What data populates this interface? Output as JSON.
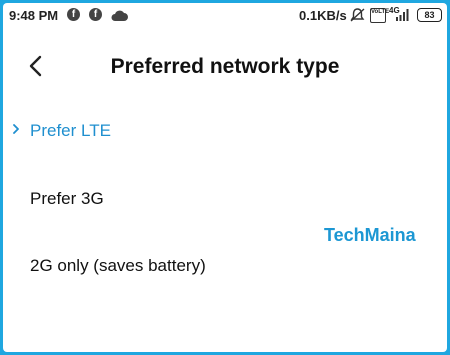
{
  "status_bar": {
    "time": "9:48 PM",
    "app_icons": [
      "facebook-icon",
      "facebook-icon",
      "cloud-icon"
    ],
    "net_speed": "0.1KB/s",
    "volte": "VoLTE",
    "network": "4G",
    "battery": "83"
  },
  "header": {
    "title": "Preferred network type",
    "back_icon": "back-arrow-icon"
  },
  "options": [
    {
      "label": "Prefer LTE",
      "selected": true
    },
    {
      "label": "Prefer 3G",
      "selected": false
    },
    {
      "label": "2G only (saves battery)",
      "selected": false
    }
  ],
  "watermark": "TechMaina",
  "colors": {
    "accent": "#1f8fcf",
    "border": "#1fa7e0",
    "watermark": "#1c97d3"
  }
}
